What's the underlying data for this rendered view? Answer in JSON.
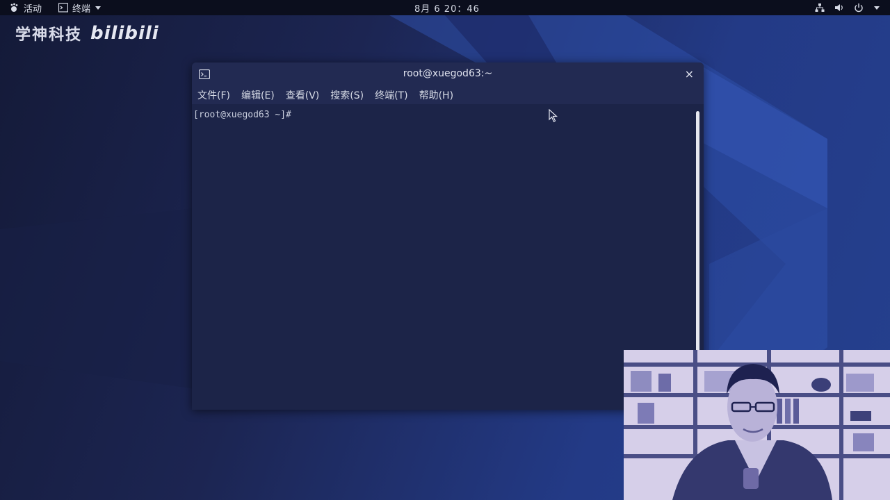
{
  "topbar": {
    "activities_label": "活动",
    "app_menu_label": "终端",
    "clock": "8月 6  20：46",
    "tray_icons": [
      "network-icon",
      "volume-icon",
      "power-icon",
      "chevron-down-icon"
    ]
  },
  "watermark": {
    "brand": "学神科技",
    "logo_text": "bilibili"
  },
  "terminal": {
    "title": "root@xuegod63:~",
    "close_glyph": "×",
    "menu": [
      "文件(F)",
      "编辑(E)",
      "查看(V)",
      "搜索(S)",
      "终端(T)",
      "帮助(H)"
    ],
    "prompt": "[root@xuegod63 ~]#"
  },
  "colors": {
    "topbar_bg": "#0b0e1d",
    "terminal_bg": "#1c2448",
    "desktop_accent": "#25408e"
  }
}
